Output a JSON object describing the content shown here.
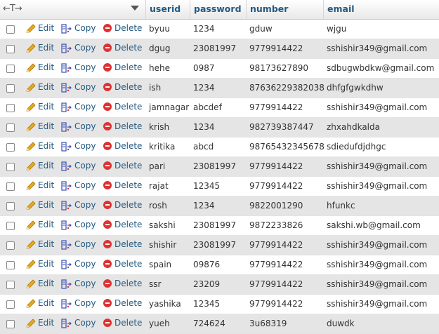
{
  "header": {
    "arrows": "←T→",
    "columns": [
      "userid",
      "password",
      "number",
      "email"
    ]
  },
  "actions": {
    "edit": "Edit",
    "copy": "Copy",
    "delete": "Delete"
  },
  "icons": {
    "edit": "pencil-icon",
    "copy": "copy-icon",
    "delete": "delete-icon"
  },
  "colors": {
    "link": "#235a81",
    "row_alt": "#e5e5e5",
    "delete": "#dd3333",
    "pencil": "#e8a81c"
  },
  "rows": [
    {
      "userid": "byuu",
      "password": "1234",
      "number": "gduw",
      "email": "wjgu"
    },
    {
      "userid": "dgug",
      "password": "23081997",
      "number": "9779914422",
      "email": "sshishir349@gmail.com"
    },
    {
      "userid": "hehe",
      "password": "0987",
      "number": "98173627890",
      "email": "sdbugwbdkw@gmail.com"
    },
    {
      "userid": "ish",
      "password": "1234",
      "number": "87636229382038",
      "email": "dhfgfgwkdhw"
    },
    {
      "userid": "jamnagar",
      "password": "abcdef",
      "number": "9779914422",
      "email": "sshishir349@gmail.com"
    },
    {
      "userid": "krish",
      "password": "1234",
      "number": "982739387447",
      "email": "zhxahdkalda"
    },
    {
      "userid": "kritika",
      "password": "abcd",
      "number": "98765432345678",
      "email": "sdiedufdjdhgc"
    },
    {
      "userid": "pari",
      "password": "23081997",
      "number": "9779914422",
      "email": "sshishir349@gmail.com"
    },
    {
      "userid": "rajat",
      "password": "12345",
      "number": "9779914422",
      "email": "sshishir349@gmail.com"
    },
    {
      "userid": "rosh",
      "password": "1234",
      "number": "9822001290",
      "email": "hfunkc"
    },
    {
      "userid": "sakshi",
      "password": "23081997",
      "number": "9872233826",
      "email": "sakshi.wb@gmail.com"
    },
    {
      "userid": "shishir",
      "password": "23081997",
      "number": "9779914422",
      "email": "sshishir349@gmail.com"
    },
    {
      "userid": "spain",
      "password": "09876",
      "number": "9779914422",
      "email": "sshishir349@gmail.com"
    },
    {
      "userid": "ssr",
      "password": "23209",
      "number": "9779914422",
      "email": "sshishir349@gmail.com"
    },
    {
      "userid": "yashika",
      "password": "12345",
      "number": "9779914422",
      "email": "sshishir349@gmail.com"
    },
    {
      "userid": "yueh",
      "password": "724624",
      "number": "3u68319",
      "email": "duwdk"
    }
  ]
}
